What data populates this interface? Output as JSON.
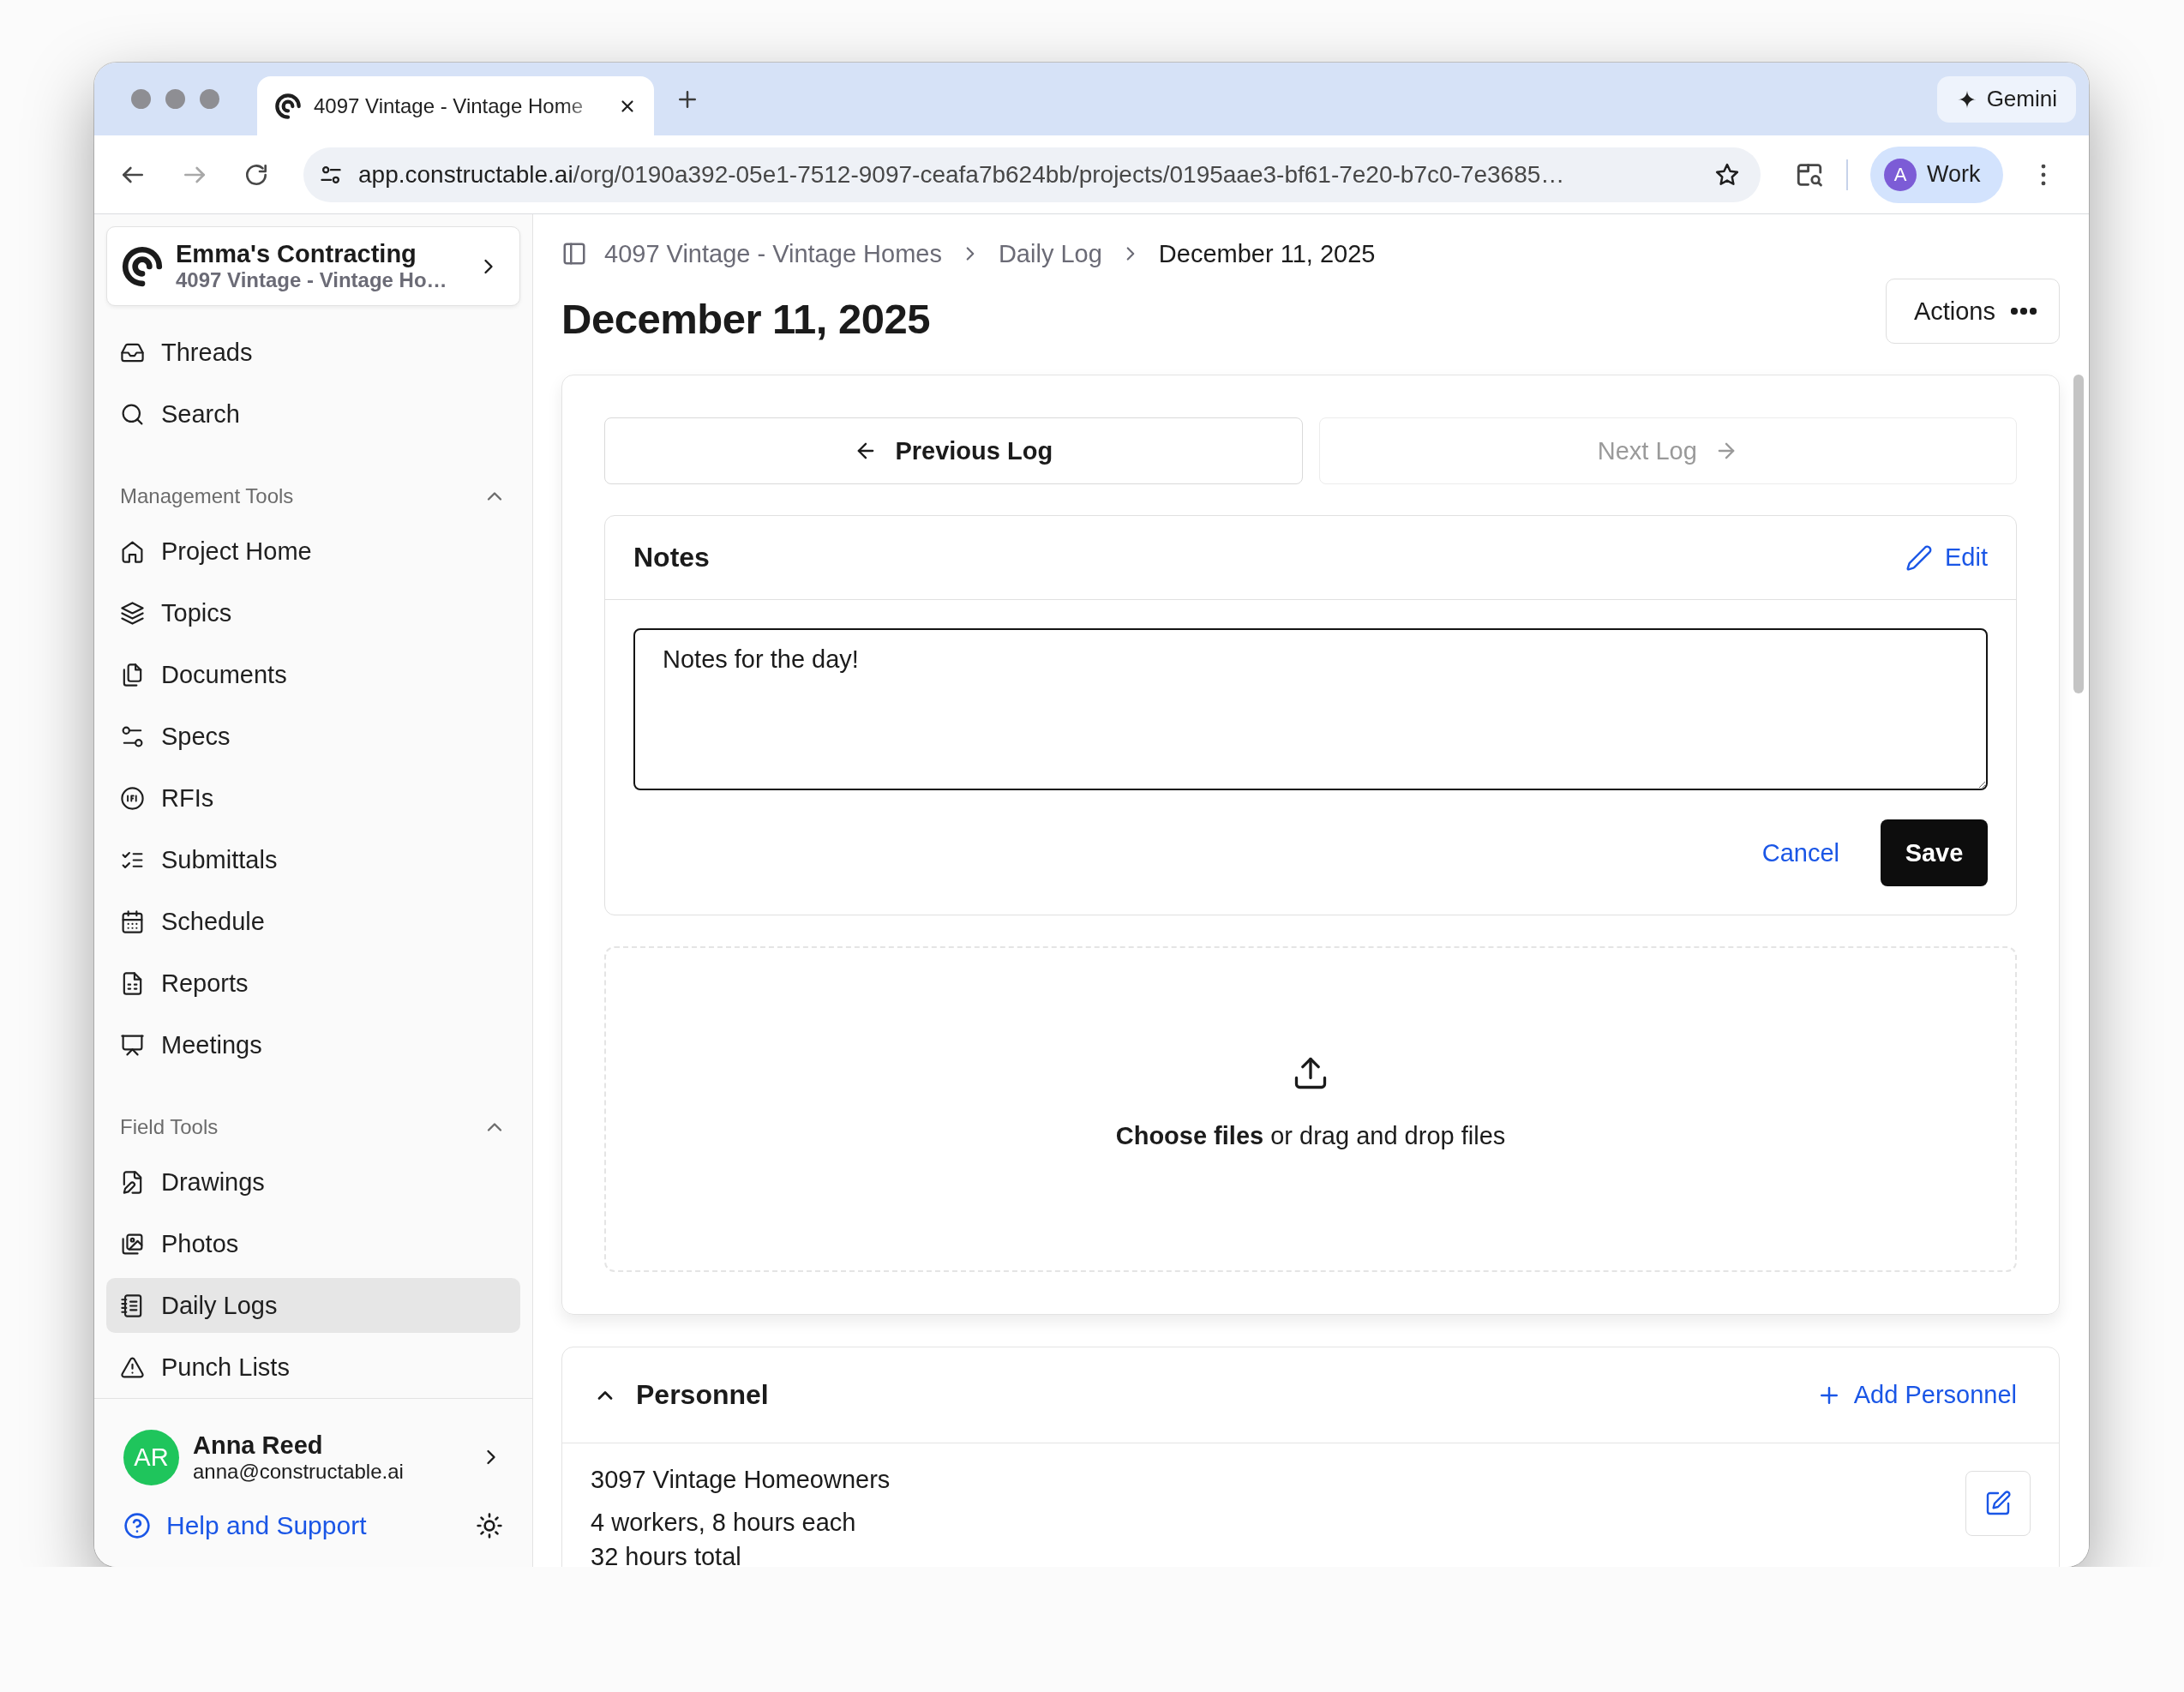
{
  "browser": {
    "tab_title": "4097 Vintage - Vintage Home",
    "gemini": "Gemini",
    "url_domain": "app.constructable.ai",
    "url_path": "/org/0190a392-05e1-7512-9097-ceafa7b624bb/projects/0195aae3-bf61-7e20-b7c0-7e3685…",
    "profile_initial": "A",
    "profile": "Work"
  },
  "sidebar": {
    "org": {
      "name": "Emma's Contracting",
      "project": "4097 Vintage - Vintage Ho…"
    },
    "top_items": [
      {
        "label": "Threads",
        "selected": false
      },
      {
        "label": "Search",
        "selected": false
      }
    ],
    "sections": [
      {
        "title": "Management Tools",
        "expanded": true,
        "items": [
          {
            "label": "Project Home",
            "selected": false
          },
          {
            "label": "Topics",
            "selected": false
          },
          {
            "label": "Documents",
            "selected": false
          },
          {
            "label": "Specs",
            "selected": false
          },
          {
            "label": "RFIs",
            "selected": false
          },
          {
            "label": "Submittals",
            "selected": false
          },
          {
            "label": "Schedule",
            "selected": false
          },
          {
            "label": "Reports",
            "selected": false
          },
          {
            "label": "Meetings",
            "selected": false
          }
        ]
      },
      {
        "title": "Field Tools",
        "expanded": true,
        "items": [
          {
            "label": "Drawings",
            "selected": false
          },
          {
            "label": "Photos",
            "selected": false
          },
          {
            "label": "Daily Logs",
            "selected": true
          },
          {
            "label": "Punch Lists",
            "selected": false
          }
        ]
      }
    ],
    "user": {
      "initials": "AR",
      "name": "Anna Reed",
      "email": "anna@constructable.ai"
    },
    "help": "Help and Support"
  },
  "main": {
    "breadcrumb": [
      "4097 Vintage - Vintage Homes",
      "Daily Log",
      "December 11, 2025"
    ],
    "title": "December 11, 2025",
    "actions": "Actions",
    "nav": [
      {
        "label": "Previous Log",
        "disabled": false
      },
      {
        "label": "Next Log",
        "disabled": true
      }
    ],
    "notes": {
      "title": "Notes",
      "edit": "Edit",
      "value": "Notes for the day!",
      "cancel": "Cancel",
      "save": "Save"
    },
    "dropzone": {
      "text": "**Choose files** or drag and drop files"
    },
    "personnel": {
      "title": "Personnel",
      "expanded": true,
      "add": "Add Personnel",
      "entries": [
        {
          "name": "3097 Vintage Homeowners",
          "detail": "4 workers, 8 hours each",
          "total": "32 hours total"
        }
      ]
    }
  }
}
